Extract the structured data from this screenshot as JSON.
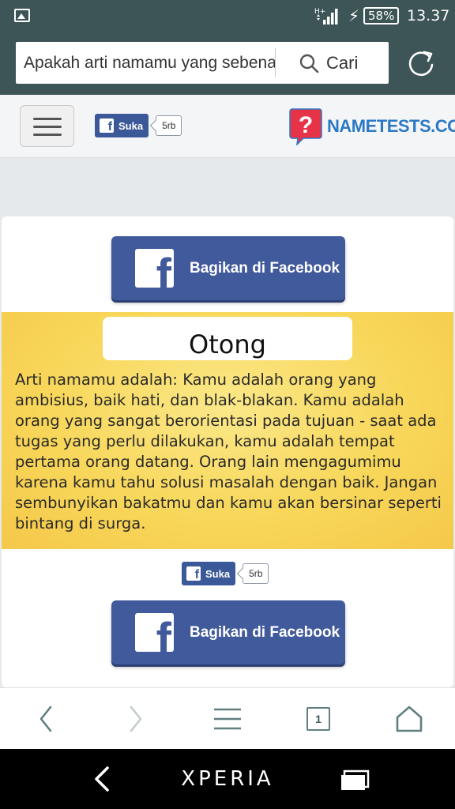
{
  "status_bar": {
    "network": "H+",
    "battery": "58%",
    "time": "13.37"
  },
  "browser": {
    "search_value": "Apakah arti namamu yang sebenarnya?",
    "search_button": "Cari"
  },
  "site": {
    "logo_text": "NAMETESTS.COM",
    "like_label": "Suka",
    "like_count": "5rb"
  },
  "result": {
    "share_label": "Bagikan di Facebook",
    "name": "Otong",
    "description": "Arti namamu adalah: Kamu adalah orang yang ambisius, baik hati, dan blak-blakan. Kamu adalah orang yang sangat berorientasi pada tujuan - saat ada tugas yang perlu dilakukan, kamu adalah tempat pertama orang datang. Orang lain mengagumimu karena kamu tahu solusi masalah dengan baik. Jangan sembunyikan bakatmu dan kamu akan bersinar seperti bintang di surga."
  },
  "toolbar": {
    "tab_count": "1"
  },
  "nav_bar": {
    "brand": "XPERIA"
  },
  "colors": {
    "status_bar": "#3d5556",
    "facebook_blue": "#415a9b",
    "logo_blue": "#2c79c5",
    "logo_red": "#e63348",
    "result_yellow": "#f8d75a"
  },
  "icons": [
    "image-icon",
    "signal-icon",
    "charging-icon",
    "search-icon",
    "reload-icon",
    "hamburger-icon",
    "facebook-icon",
    "question-bubble-icon",
    "back-arrow-icon",
    "forward-arrow-icon",
    "menu-icon",
    "tabs-icon",
    "home-icon",
    "nav-back-icon",
    "recent-apps-icon"
  ]
}
